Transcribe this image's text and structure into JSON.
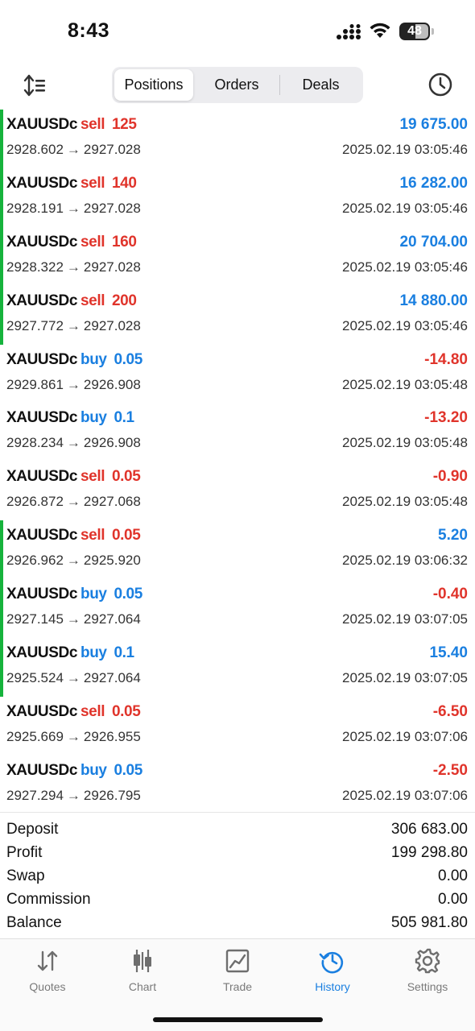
{
  "status_bar": {
    "time": "8:43",
    "battery": "48"
  },
  "segments": {
    "positions": "Positions",
    "orders": "Orders",
    "deals": "Deals",
    "active": "Positions"
  },
  "deals": [
    {
      "symbol": "XAUUSDc",
      "side": "sell",
      "volume": "125",
      "open_price": "2928.602",
      "close_price": "2927.028",
      "profit": "19 675.00",
      "datetime": "2025.02.19 03:05:46",
      "bar": true
    },
    {
      "symbol": "XAUUSDc",
      "side": "sell",
      "volume": "140",
      "open_price": "2928.191",
      "close_price": "2927.028",
      "profit": "16 282.00",
      "datetime": "2025.02.19 03:05:46",
      "bar": true
    },
    {
      "symbol": "XAUUSDc",
      "side": "sell",
      "volume": "160",
      "open_price": "2928.322",
      "close_price": "2927.028",
      "profit": "20 704.00",
      "datetime": "2025.02.19 03:05:46",
      "bar": true
    },
    {
      "symbol": "XAUUSDc",
      "side": "sell",
      "volume": "200",
      "open_price": "2927.772",
      "close_price": "2927.028",
      "profit": "14 880.00",
      "datetime": "2025.02.19 03:05:46",
      "bar": true
    },
    {
      "symbol": "XAUUSDc",
      "side": "buy",
      "volume": "0.05",
      "open_price": "2929.861",
      "close_price": "2926.908",
      "profit": "-14.80",
      "datetime": "2025.02.19 03:05:48",
      "bar": false
    },
    {
      "symbol": "XAUUSDc",
      "side": "buy",
      "volume": "0.1",
      "open_price": "2928.234",
      "close_price": "2926.908",
      "profit": "-13.20",
      "datetime": "2025.02.19 03:05:48",
      "bar": false
    },
    {
      "symbol": "XAUUSDc",
      "side": "sell",
      "volume": "0.05",
      "open_price": "2926.872",
      "close_price": "2927.068",
      "profit": "-0.90",
      "datetime": "2025.02.19 03:05:48",
      "bar": false
    },
    {
      "symbol": "XAUUSDc",
      "side": "sell",
      "volume": "0.05",
      "open_price": "2926.962",
      "close_price": "2925.920",
      "profit": "5.20",
      "datetime": "2025.02.19 03:06:32",
      "bar": true
    },
    {
      "symbol": "XAUUSDc",
      "side": "buy",
      "volume": "0.05",
      "open_price": "2927.145",
      "close_price": "2927.064",
      "profit": "-0.40",
      "datetime": "2025.02.19 03:07:05",
      "bar": true
    },
    {
      "symbol": "XAUUSDc",
      "side": "buy",
      "volume": "0.1",
      "open_price": "2925.524",
      "close_price": "2927.064",
      "profit": "15.40",
      "datetime": "2025.02.19 03:07:05",
      "bar": true
    },
    {
      "symbol": "XAUUSDc",
      "side": "sell",
      "volume": "0.05",
      "open_price": "2925.669",
      "close_price": "2926.955",
      "profit": "-6.50",
      "datetime": "2025.02.19 03:07:06",
      "bar": false
    },
    {
      "symbol": "XAUUSDc",
      "side": "buy",
      "volume": "0.05",
      "open_price": "2927.294",
      "close_price": "2926.795",
      "profit": "-2.50",
      "datetime": "2025.02.19 03:07:06",
      "bar": false
    }
  ],
  "summary": {
    "deposit_label": "Deposit",
    "deposit": "306 683.00",
    "profit_label": "Profit",
    "profit": "199 298.80",
    "swap_label": "Swap",
    "swap": "0.00",
    "commission_label": "Commission",
    "commission": "0.00",
    "balance_label": "Balance",
    "balance": "505 981.80"
  },
  "tabbar": {
    "quotes": "Quotes",
    "chart": "Chart",
    "trade": "Trade",
    "history": "History",
    "settings": "Settings",
    "active": "History"
  },
  "colors": {
    "accent": "#1a7fe0",
    "sell": "#e0342b",
    "profit_bar": "#16b33c"
  }
}
